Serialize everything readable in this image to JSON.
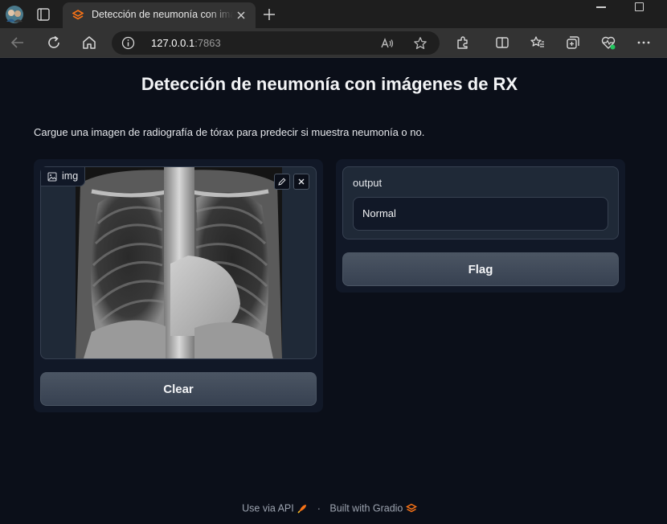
{
  "browser": {
    "tab": {
      "title": "Detección de neumonía con imágenes de RX"
    },
    "address": {
      "host": "127.0.0.1",
      "port": ":7863"
    }
  },
  "page": {
    "title": "Detección de neumonía con imágenes de RX",
    "description": "Cargue una imagen de radiografía de tórax para predecir si muestra neumonía o no."
  },
  "input": {
    "label": "img",
    "clear_label": "Clear"
  },
  "output": {
    "label": "output",
    "value": "Normal",
    "flag_label": "Flag"
  },
  "footer": {
    "api_label": "Use via API",
    "separator": "·",
    "built_label": "Built with Gradio"
  },
  "colors": {
    "background": "#0b0f19",
    "panel": "#111827",
    "block": "#1f2937",
    "border": "#374151",
    "button": "#4b5563",
    "gradio_accent": "#f97316"
  }
}
